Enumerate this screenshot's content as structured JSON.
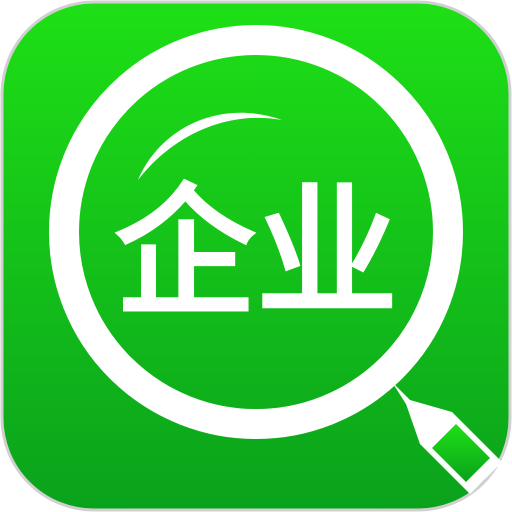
{
  "icon": {
    "name": "enterprise-search-app-icon",
    "label": "企业",
    "colors": {
      "background_top": "#1ee016",
      "background_bottom": "#0aa21c",
      "outline": "#d0d0d0",
      "foreground": "#ffffff"
    }
  }
}
